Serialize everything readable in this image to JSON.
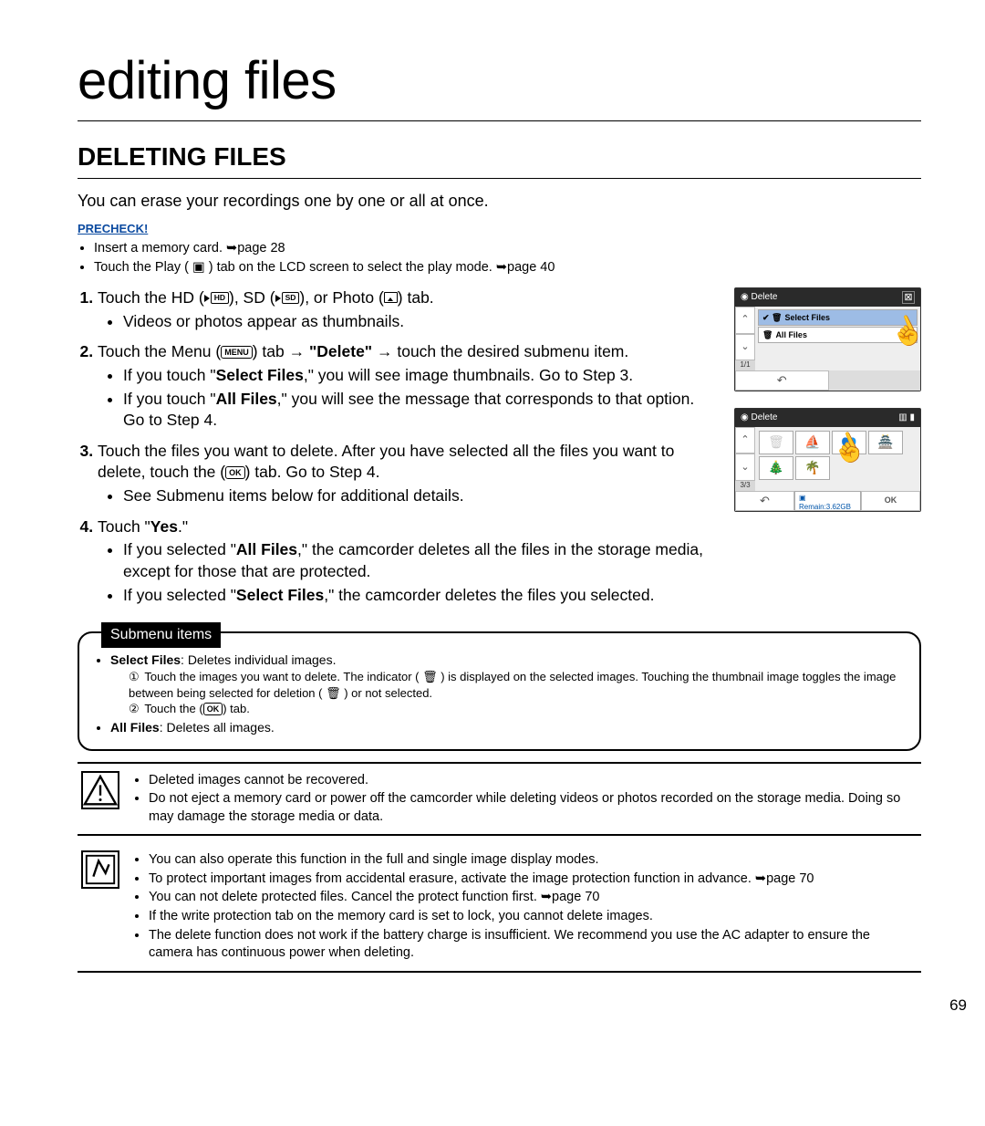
{
  "chapter": "editing files",
  "section": "DELETING FILES",
  "intro": "You can erase your recordings one by one or all at once.",
  "precheck": {
    "label": "PRECHECK!",
    "items": [
      "Insert a memory card. ➥page 28",
      "Touch the Play ( ▣ ) tab on the LCD screen to select the play mode. ➥page 40"
    ]
  },
  "icons": {
    "hd": "HD",
    "sd": "SD",
    "menu": "MENU",
    "ok": "OK"
  },
  "steps": {
    "s1": {
      "pre": "Touch the HD (",
      "mid1": "), SD (",
      "mid2": "), or Photo (",
      "post": ") tab.",
      "sub": [
        "Videos or photos appear as thumbnails."
      ]
    },
    "s2": {
      "pre": "Touch the Menu (",
      "post1": ") tab ",
      "delete": "\"Delete\"",
      "post2": " touch the desired submenu item.",
      "sub": [
        "If you touch \"Select Files,\" you will see image thumbnails. Go to Step 3.",
        "If you touch \"All Files,\" you will see the message that corresponds to that option. Go to Step 4."
      ],
      "bold1": "Select Files",
      "bold2": "All Files"
    },
    "s3": {
      "pre": "Touch the files you want to delete. After you have selected all the files you want to delete, touch the (",
      "post": ") tab. Go to Step 4.",
      "sub": [
        "See Submenu items below for additional details."
      ]
    },
    "s4": {
      "text": "Touch \"Yes.\"",
      "yes": "Yes",
      "sub1_pre": "If you selected \"",
      "sub1_bold": "All Files",
      "sub1_post": ",\" the camcorder deletes all the files in the storage media, except for those that are protected.",
      "sub2_pre": "If you selected \"",
      "sub2_bold": "Select Files",
      "sub2_post": ",\" the camcorder deletes the files you selected."
    }
  },
  "lcd": {
    "delete": "Delete",
    "select_files": "Select Files",
    "all_files": "All Files",
    "page1": "1/1",
    "page2": "3/3",
    "remain": "Remain:3.62GB",
    "ok": "OK"
  },
  "submenu": {
    "title": "Submenu items",
    "sf_label": "Select Files",
    "sf_desc": ": Deletes individual images.",
    "sf1": "Touch the images you want to delete. The indicator ( 🗑 ) is displayed on the selected images. Touching the thumbnail image toggles the image between being selected for deletion ( 🗑 ) or not selected.",
    "sf2_pre": "Touch the (",
    "sf2_post": ") tab.",
    "af_label": "All Files",
    "af_desc": ": Deletes all images."
  },
  "warn": [
    "Deleted images cannot be recovered.",
    "Do not eject a memory card or power off the camcorder while deleting videos or photos recorded on the storage media. Doing so may damage the storage media or data."
  ],
  "notes": [
    "You can also operate this function in the full and single image display modes.",
    "To protect important images from accidental erasure, activate the image protection function in advance. ➥page 70",
    "You can not delete protected files. Cancel the protect function first. ➥page 70",
    "If the write protection tab on the memory card is set to lock, you cannot delete images.",
    "The delete function does not work if the battery charge is insufficient. We recommend you use the AC adapter to ensure the camera has continuous power when deleting."
  ],
  "page_number": "69"
}
